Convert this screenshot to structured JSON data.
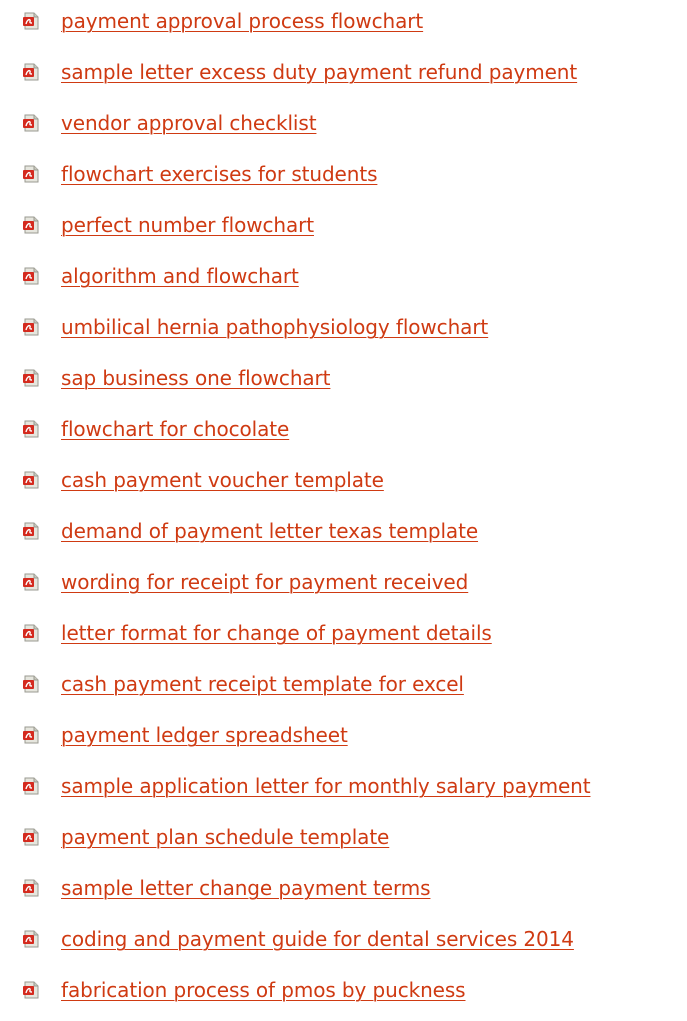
{
  "links": [
    {
      "label": "payment approval process flowchart"
    },
    {
      "label": "sample letter excess duty payment refund payment"
    },
    {
      "label": "vendor approval checklist"
    },
    {
      "label": "flowchart exercises for students"
    },
    {
      "label": "perfect number flowchart"
    },
    {
      "label": "algorithm and flowchart"
    },
    {
      "label": "umbilical hernia pathophysiology flowchart"
    },
    {
      "label": "sap business one flowchart"
    },
    {
      "label": "flowchart for chocolate"
    },
    {
      "label": "cash payment voucher template"
    },
    {
      "label": "demand of payment letter texas template"
    },
    {
      "label": "wording for receipt for payment received"
    },
    {
      "label": "letter format for change of payment details"
    },
    {
      "label": "cash payment receipt template for excel"
    },
    {
      "label": "payment ledger spreadsheet"
    },
    {
      "label": "sample application letter for monthly salary payment"
    },
    {
      "label": "payment plan schedule template"
    },
    {
      "label": "sample letter change payment terms"
    },
    {
      "label": "coding and payment guide for dental services 2014"
    },
    {
      "label": "fabrication process of pmos by puckness"
    }
  ],
  "icon": "pdf-file-icon",
  "colors": {
    "link": "#cf3a12",
    "icon_red": "#d42a1e",
    "icon_page": "#e6e6de"
  }
}
